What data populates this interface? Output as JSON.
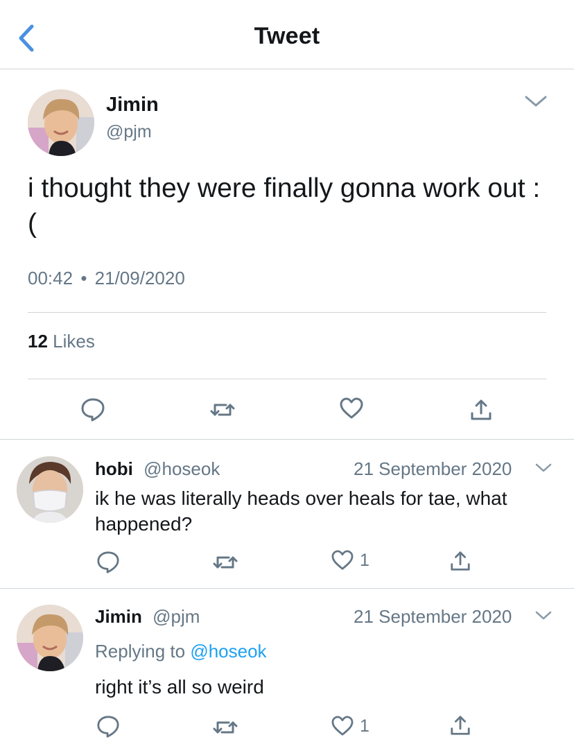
{
  "header": {
    "title": "Tweet"
  },
  "main_tweet": {
    "name": "Jimin",
    "handle": "@pjm",
    "text": "i thought they were finally gonna work out :(",
    "time": "00:42",
    "separator": "•",
    "date": "21/09/2020",
    "likes_count": "12",
    "likes_label": "Likes"
  },
  "replies": [
    {
      "name": "hobi",
      "handle": "@hoseok",
      "date": "21 September 2020",
      "text": "ik he was literally heads over heals for tae, what happened?",
      "like_count": "1"
    },
    {
      "name": "Jimin",
      "handle": "@pjm",
      "date": "21 September 2020",
      "replying_label": "Replying to",
      "replying_to": "@hoseok",
      "text": "right it’s all so weird",
      "like_count": "1"
    }
  ],
  "colors": {
    "accent": "#1da1f2",
    "muted": "#657786",
    "back": "#4a90e2",
    "divider": "#cfd4d9"
  }
}
